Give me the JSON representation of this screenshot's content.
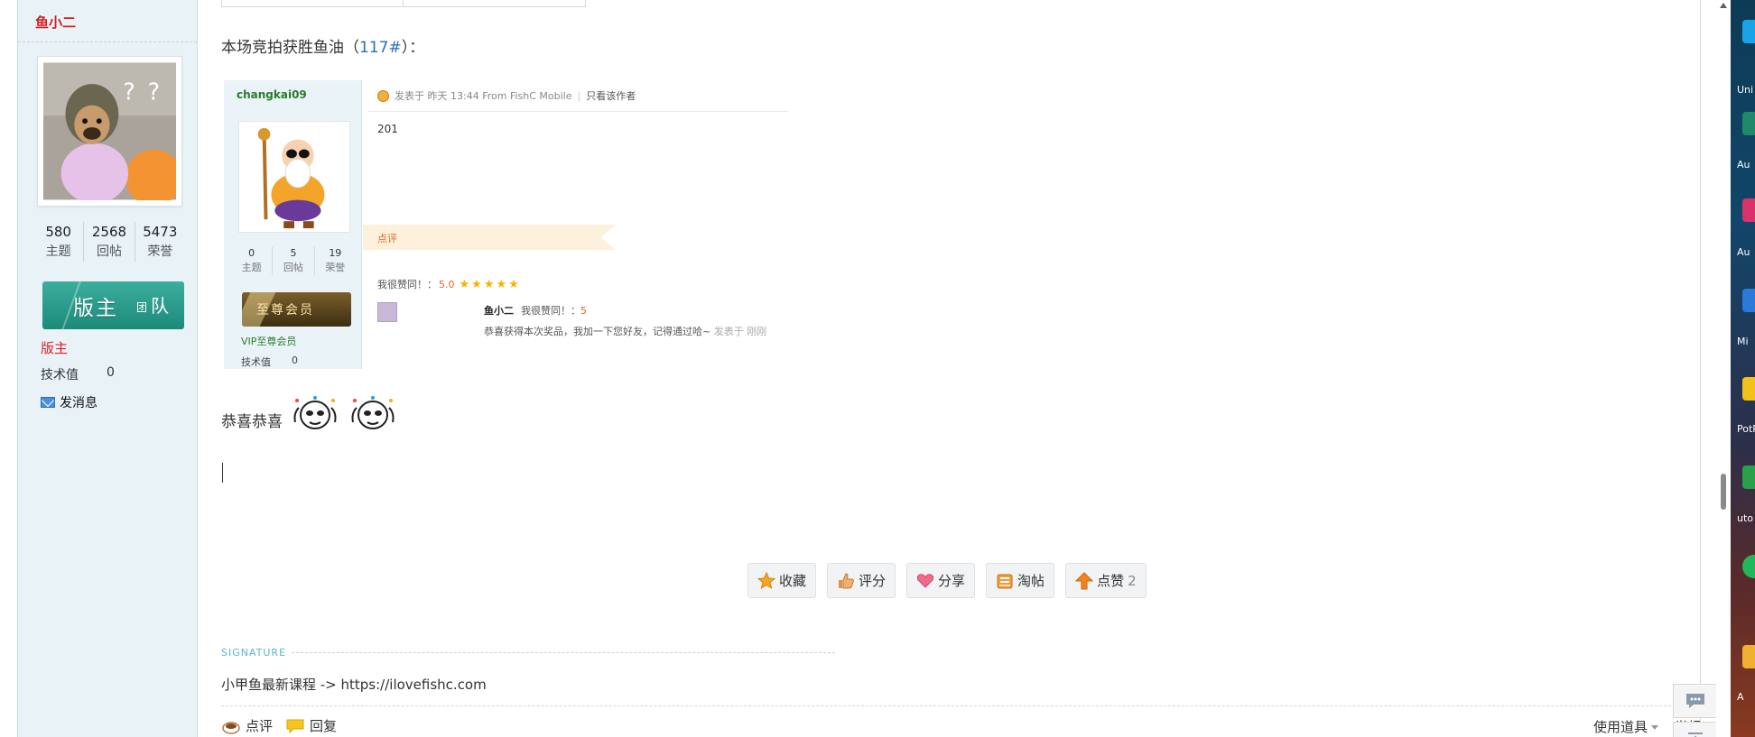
{
  "sidebar": {
    "username": "鱼小二",
    "stats": [
      {
        "value": "580",
        "label": "主题"
      },
      {
        "value": "2568",
        "label": "回帖"
      },
      {
        "value": "5473",
        "label": "荣誉"
      }
    ],
    "badge": {
      "big": "版主",
      "small": "团",
      "big2": "队"
    },
    "role": "版主",
    "skill_label": "技术值",
    "skill_value": "0",
    "send_message": "发消息"
  },
  "post": {
    "headline_prefix": "本场竞拍获胜鱼油（",
    "headline_link": "117#",
    "headline_suffix": "）：",
    "congrats_text": "恭喜恭喜"
  },
  "embed": {
    "username": "changkai09",
    "meta": "发表于 昨天 13:44 From FishC Mobile",
    "only_author": "只看该作者",
    "content": "201",
    "stats": [
      {
        "value": "0",
        "label": "主题"
      },
      {
        "value": "5",
        "label": "回帖"
      },
      {
        "value": "19",
        "label": "荣誉"
      }
    ],
    "vip_badge": "至尊会员",
    "vip_label": "VIP至尊会员",
    "skill_label": "技术值",
    "skill_value": "0",
    "comment_tab": "点评",
    "rate_label": "我很赞同！：",
    "rate_score": "5.0",
    "rater_name": "鱼小二",
    "rater_label": "我很赞同！：",
    "rater_score": "5",
    "rater_text": "恭喜获得本次奖品，我加一下您好友，记得通过哈~",
    "rater_time": "发表于 刚刚"
  },
  "actions": [
    {
      "label": "收藏",
      "icon": "star-icon"
    },
    {
      "label": "评分",
      "icon": "thumbs-up-icon"
    },
    {
      "label": "分享",
      "icon": "heart-icon"
    },
    {
      "label": "淘帖",
      "icon": "archive-tray-icon"
    },
    {
      "label": "点赞",
      "icon": "arrow-up-icon",
      "count": "2"
    }
  ],
  "signature": {
    "label": "SIGNATURE",
    "text": "小甲鱼最新课程 -> https://ilovefishc.com"
  },
  "footer": {
    "comment": "点评",
    "reply": "回复",
    "tools": "使用道具",
    "report": "举报"
  },
  "desktop_icons": [
    {
      "label": "Uni",
      "color": "#1aa3e8"
    },
    {
      "label": "Au",
      "color": "#1e8a6a"
    },
    {
      "label": "Au",
      "color": "#d8336a"
    },
    {
      "label": "Mi",
      "color": "#2a7ad8"
    },
    {
      "label": "PotP",
      "color": "#f2c21a"
    },
    {
      "label": "uto",
      "color": "#2aa04a"
    },
    {
      "label": "",
      "color": "#22b85a"
    },
    {
      "label": "A",
      "color": "#f0b030"
    }
  ],
  "colors": {
    "accent_link": "#2b6db5",
    "role_red": "#e02020",
    "sidebar_bg": "#e8f2f7",
    "comment_orange": "#e0672a"
  }
}
